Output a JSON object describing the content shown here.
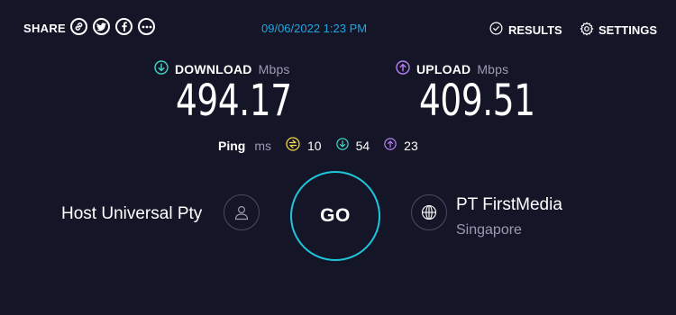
{
  "header": {
    "share_label": "SHARE",
    "share_icons": [
      "link-icon",
      "twitter-icon",
      "facebook-icon",
      "more-icon"
    ],
    "timestamp": "09/06/2022 1:23 PM",
    "results_label": "RESULTS",
    "settings_label": "SETTINGS"
  },
  "download": {
    "label": "DOWNLOAD",
    "unit": "Mbps",
    "value": "494.17",
    "color": "#40d6c4"
  },
  "upload": {
    "label": "UPLOAD",
    "unit": "Mbps",
    "value": "409.51",
    "color": "#b780f5"
  },
  "ping": {
    "label": "Ping",
    "unit": "ms",
    "idle": "10",
    "download": "54",
    "upload": "23",
    "colors": {
      "idle": "#f5d64a",
      "download": "#40d6c4",
      "upload": "#b780f5"
    }
  },
  "connection": {
    "isp": "Host Universal Pty",
    "go_label": "GO",
    "server_name": "PT FirstMedia",
    "server_location": "Singapore",
    "accent": "#1ec6dc"
  }
}
